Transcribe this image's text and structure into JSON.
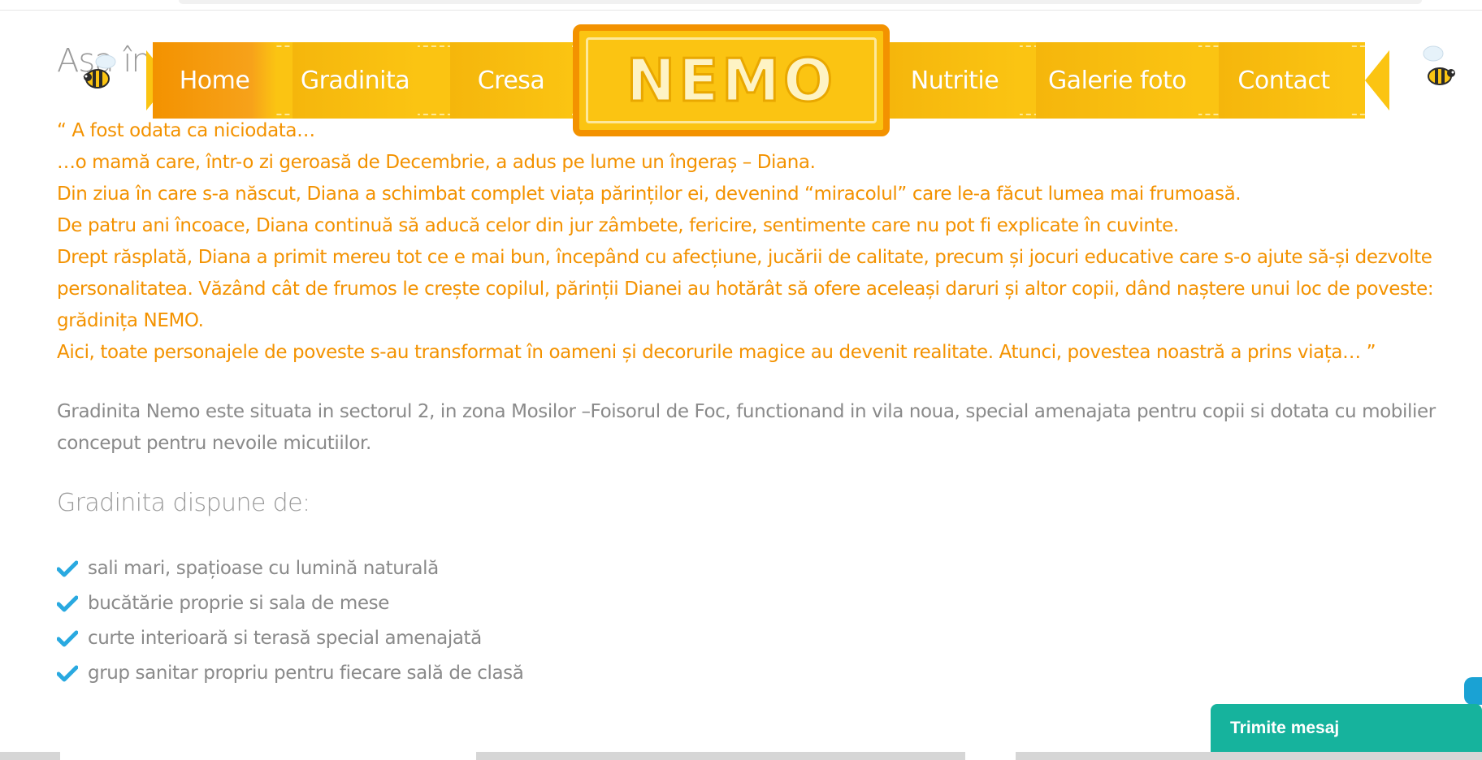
{
  "page": {
    "title": "Aşa începe",
    "story": [
      "“ A fost odata ca niciodata…",
      "…o mamă care, într-o zi geroasă de Decembrie, a adus pe lume un îngeraș – Diana.",
      "Din ziua în care s-a născut, Diana a schimbat complet viața părinților ei, devenind “miracolul” care le-a făcut lumea mai frumoasă.",
      "De patru ani încoace, Diana continuă să aducă celor din jur zâmbete, fericire, sentimente care nu pot fi explicate în cuvinte.",
      "Drept răsplată, Diana a primit mereu tot ce e mai bun, începând cu afecțiune, jucării de calitate, precum și jocuri educative care s-o ajute să-și dezvolte personalitatea. Văzând cât de frumos le crește copilul, părinții Dianei au hotărât să ofere aceleași daruri și altor copii, dând naștere unui loc de poveste: grădinița NEMO.",
      "Aici, toate personajele de poveste s-au transformat în oameni și decorurile magice au devenit realitate. Atunci, povestea noastră a prins viața… ”"
    ],
    "description": "Gradinita Nemo este situata in sectorul 2, in zona Mosilor –Foisorul de Foc, functionand in vila noua, special amenajata pentru copii si dotata cu mobilier conceput pentru nevoile micutiilor.",
    "features_title": "Gradinita dispune de:",
    "features": [
      "sali mari, spațioase cu lumină naturală",
      "bucătărie proprie si sala de mese",
      "curte interioară si terasă special amenajată",
      "grup sanitar propriu pentru fiecare sală de clasă"
    ]
  },
  "nav": {
    "logo": "NEMO",
    "items": [
      "Home",
      "Gradinita",
      "Cresa",
      "Nutritie",
      "Galerie foto",
      "Contact"
    ],
    "active": "Home"
  },
  "chat": {
    "label": "Trimite mesaj"
  },
  "colors": {
    "accent_orange": "#f39200",
    "ribbon_yellow": "#fbc412",
    "check_blue": "#29a9e0",
    "chat_teal": "#16b39d"
  },
  "icons": {
    "feature_bullet": "check-icon",
    "decor": "bee-icon"
  }
}
